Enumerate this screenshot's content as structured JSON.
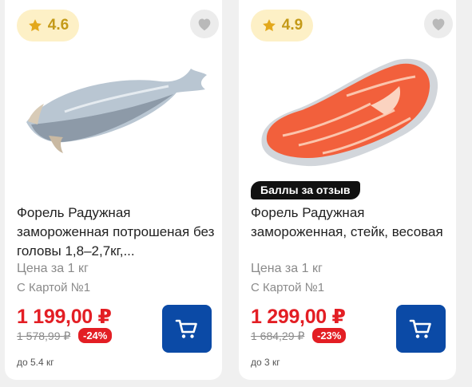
{
  "products": [
    {
      "rating": "4.6",
      "title": "Форель Радужная замороженная потрошеная без головы 1,8–2,7кг,...",
      "unit_label": "Цена за 1 кг",
      "card_label": "С Картой №1",
      "price": "1 199,00 ₽",
      "old_price": "1 578,99 ₽",
      "discount": "-24%",
      "weight_note": "до 5.4 кг"
    },
    {
      "rating": "4.9",
      "badge": "Баллы за отзыв",
      "title": "Форель Радужная замороженная, стейк, весовая",
      "unit_label": "Цена за 1 кг",
      "card_label": "С Картой №1",
      "price": "1 299,00 ₽",
      "old_price": "1 684,29 ₽",
      "discount": "-23%",
      "weight_note": "до 3 кг"
    }
  ],
  "colors": {
    "price_red": "#e31e24",
    "cart_blue": "#0b4aa6",
    "rating_bg": "#fdf0c6",
    "star": "#e3a81b"
  },
  "icons": {
    "rating": "star-icon",
    "favorite": "heart-icon",
    "cart": "cart-icon"
  }
}
